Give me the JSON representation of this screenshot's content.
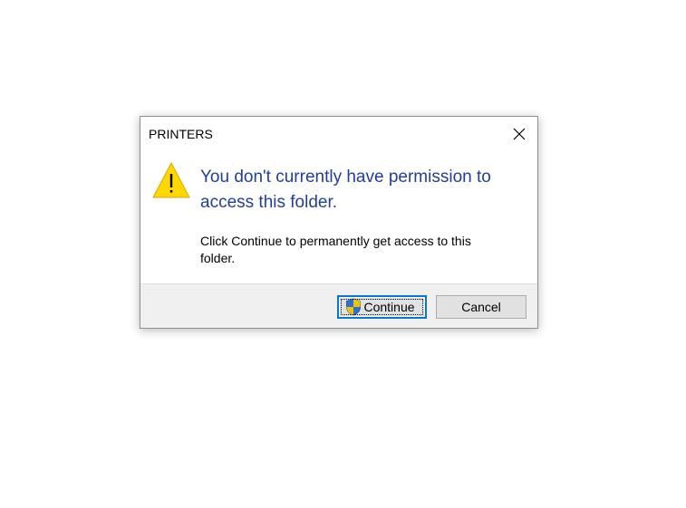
{
  "dialog": {
    "title": "PRINTERS",
    "close_icon": "close-icon",
    "warning_icon": "warning-icon",
    "main_instruction": "You don't currently have permission to access this folder.",
    "secondary_text": "Click Continue to permanently get access to this folder.",
    "buttons": {
      "continue_label": "Continue",
      "continue_icon": "uac-shield-icon",
      "cancel_label": "Cancel"
    }
  },
  "colors": {
    "instruction_text": "#1f3f9a",
    "focus_border": "#0078d7",
    "footer_background": "#f0f0f0",
    "warning_yellow": "#ffd800"
  }
}
